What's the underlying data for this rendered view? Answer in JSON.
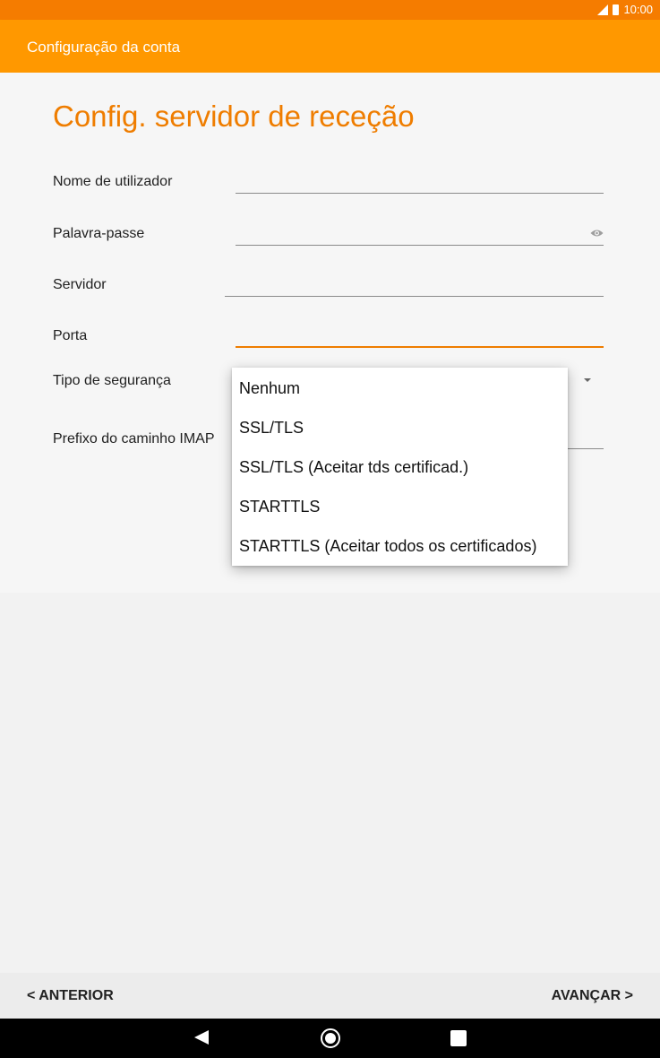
{
  "status_bar": {
    "time": "10:00"
  },
  "app_bar": {
    "title": "Configuração da conta"
  },
  "page": {
    "title": "Config. servidor de receção"
  },
  "fields": {
    "username_label": "Nome de utilizador",
    "password_label": "Palavra-passe",
    "server_label": "Servidor",
    "port_label": "Porta",
    "security_label": "Tipo de segurança",
    "imap_prefix_label": "Prefixo do caminho IMAP"
  },
  "security_menu": {
    "options": [
      "Nenhum",
      "SSL/TLS",
      "SSL/TLS (Aceitar tds certificad.)",
      "STARTTLS",
      "STARTTLS (Aceitar todos os certificados)"
    ]
  },
  "footer": {
    "previous_label": "< ANTERIOR",
    "next_label": "AVANÇAR >"
  },
  "colors": {
    "accent": "#ff9800",
    "status_bar": "#f57c00",
    "title": "#ef7d00"
  },
  "icons": [
    "signal-icon",
    "battery-icon",
    "eye-icon",
    "dropdown-arrow-icon",
    "back-icon",
    "home-icon",
    "recent-apps-icon"
  ]
}
